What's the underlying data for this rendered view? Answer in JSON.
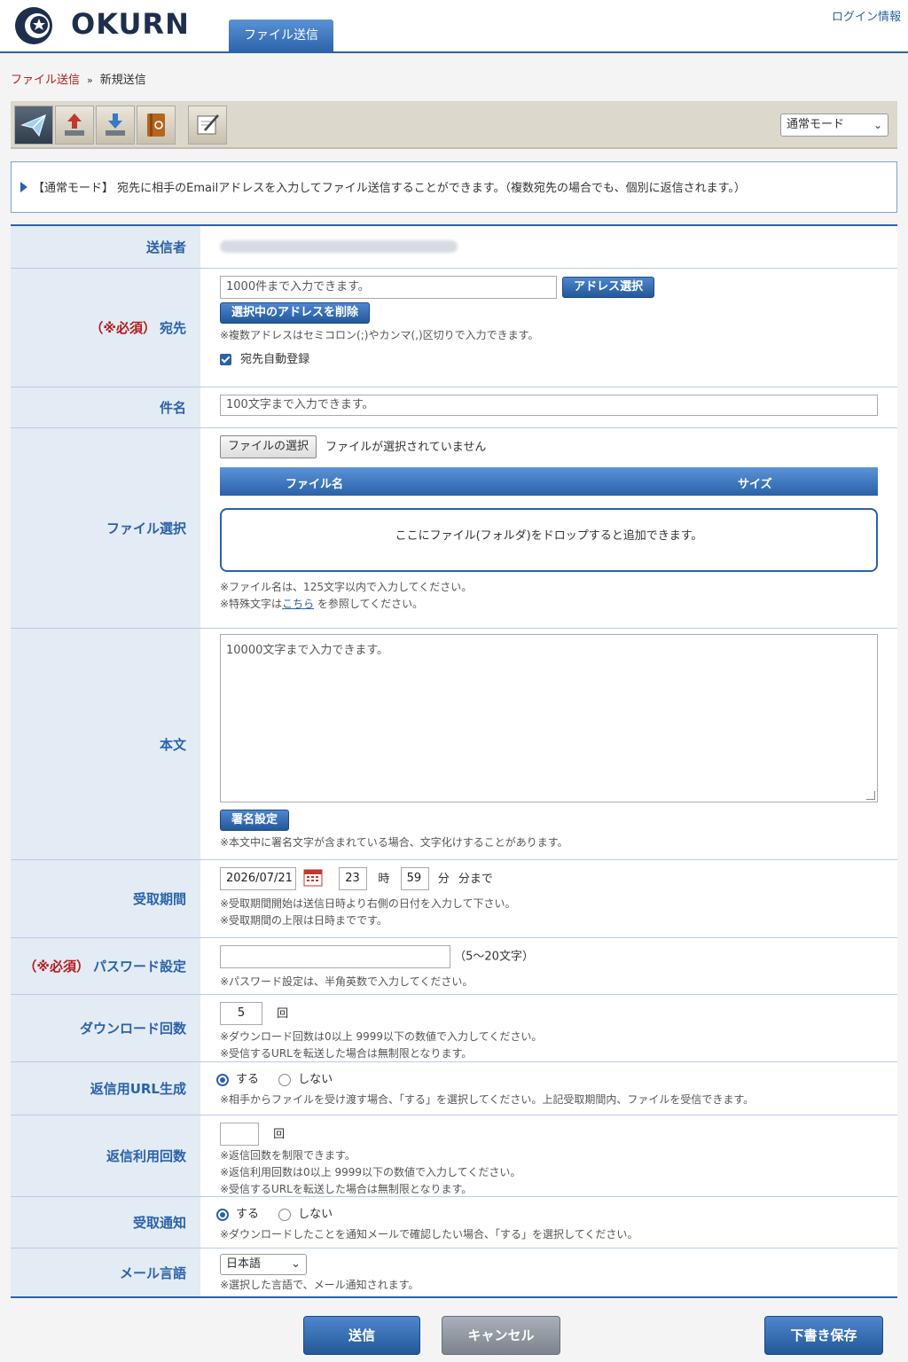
{
  "header": {
    "logo_text": "OKURN",
    "main_tab": "ファイル送信",
    "login_info": "ログイン情報"
  },
  "breadcrumb": {
    "link": "ファイル送信",
    "separator": "»",
    "current": "新規送信"
  },
  "toolbar": {
    "tools": [
      "send-icon",
      "upload-icon",
      "download-icon",
      "address-book-icon",
      "edit-icon"
    ],
    "mode_select": "通常モード"
  },
  "info": {
    "text": "【通常モード】 宛先に相手のEmailアドレスを入力してファイル送信することができます。（複数宛先の場合でも、個別に返信されます。）"
  },
  "form": {
    "sender": {
      "label": "送信者"
    },
    "recipient": {
      "required": "（※必須）",
      "label": "宛先",
      "placeholder": "1000件まで入力できます。",
      "address_button": "アドレス選択",
      "delete_button": "選択中のアドレスを削除",
      "note": "※複数アドレスはセミコロン(;)やカンマ(,)区切りで入力できます。",
      "auto_register": "宛先自動登録"
    },
    "subject": {
      "label": "件名",
      "placeholder": "100文字まで入力できます。"
    },
    "file": {
      "label": "ファイル選択",
      "choose_button": "ファイルの選択",
      "no_file": "ファイルが選択されていません",
      "col_name": "ファイル名",
      "col_size": "サイズ",
      "drop_text": "ここにファイル(フォルダ)をドロップすると追加できます。",
      "note1": "※ファイル名は、125文字以内で入力してください。",
      "note2_pre": "※特殊文字は",
      "note2_link": "こちら",
      "note2_post": "を参照してください。"
    },
    "body": {
      "label": "本文",
      "placeholder": "10000文字まで入力できます。",
      "signature_button": "署名設定",
      "note": "※本文中に署名文字が含まれている場合、文字化けすることがあります。"
    },
    "period": {
      "label": "受取期間",
      "date": "2026/07/21",
      "hour": "23",
      "hour_unit": "時",
      "minute": "59",
      "minute_unit": "分",
      "until": "分まで",
      "note1": "※受取期間開始は送信日時より右側の日付を入力して下さい。",
      "note2": "※受取期間の上限は日時までです。"
    },
    "password": {
      "required": "（※必須）",
      "label": "パスワード設定",
      "hint": "（5〜20文字）",
      "note": "※パスワード設定は、半角英数で入力してください。"
    },
    "download_count": {
      "label": "ダウンロード回数",
      "value": "5",
      "unit": "回",
      "note1": "※ダウンロード回数は0以上 9999以下の数値で入力してください。",
      "note2": "※受信するURLを転送した場合は無制限となります。"
    },
    "reply_url": {
      "label": "返信用URL生成",
      "yes": "する",
      "no": "しない",
      "note": "※相手からファイルを受け渡す場合、「する」を選択してください。上記受取期間内、ファイルを受信できます。"
    },
    "reply_count": {
      "label": "返信利用回数",
      "unit": "回",
      "note1": "※返信回数を制限できます。",
      "note2": "※返信利用回数は0以上 9999以下の数値で入力してください。",
      "note3": "※受信するURLを転送した場合は無制限となります。"
    },
    "notify": {
      "label": "受取通知",
      "yes": "する",
      "no": "しない",
      "note": "※ダウンロードしたことを通知メールで確認したい場合、「する」を選択してください。"
    },
    "language": {
      "label": "メール言語",
      "value": "日本語",
      "note": "※選択した言語で、メール通知されます。"
    }
  },
  "footer": {
    "send": "送信",
    "cancel": "キャンセル",
    "draft": "下書き保存"
  },
  "colors": {
    "brand": "#2a62a8",
    "required": "#b51c1c"
  }
}
